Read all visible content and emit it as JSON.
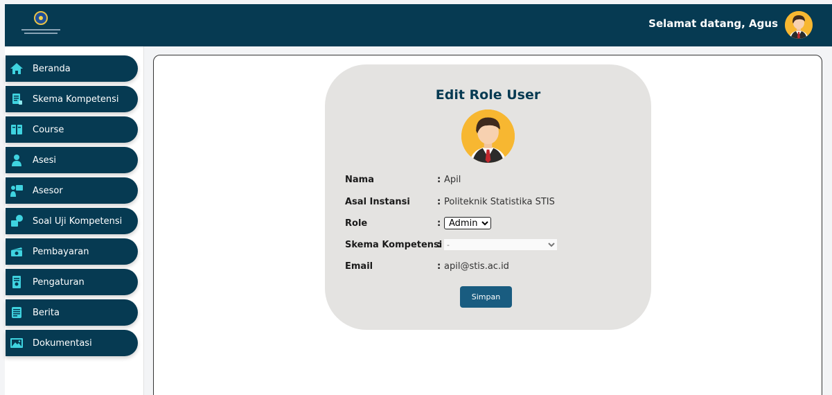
{
  "header": {
    "welcome_text": "Selamat datang, Agus",
    "background_color": "#063a52"
  },
  "sidebar": {
    "items": [
      {
        "label": "Beranda",
        "icon": "home-icon"
      },
      {
        "label": "Skema Kompetensi",
        "icon": "document-icon"
      },
      {
        "label": "Course",
        "icon": "book-icon"
      },
      {
        "label": "Asesi",
        "icon": "user-icon"
      },
      {
        "label": "Asesor",
        "icon": "presenter-icon"
      },
      {
        "label": "Soal Uji Kompetensi",
        "icon": "quiz-icon"
      },
      {
        "label": "Pembayaran",
        "icon": "money-icon"
      },
      {
        "label": "Pengaturan",
        "icon": "settings-icon"
      },
      {
        "label": "Berita",
        "icon": "news-icon"
      },
      {
        "label": "Dokumentasi",
        "icon": "image-icon"
      }
    ]
  },
  "form": {
    "title": "Edit Role User",
    "fields": {
      "nama": {
        "label": "Nama",
        "value": "Apil"
      },
      "instansi": {
        "label": "Asal Instansi",
        "value": "Politeknik Statistika STIS"
      },
      "role": {
        "label": "Role",
        "value": "Admin"
      },
      "skema": {
        "label": "Skema Kompetensi",
        "value": "-"
      },
      "email": {
        "label": "Email",
        "value": "apil@stis.ac.id"
      }
    },
    "colon": ":",
    "save_label": "Simpan"
  }
}
